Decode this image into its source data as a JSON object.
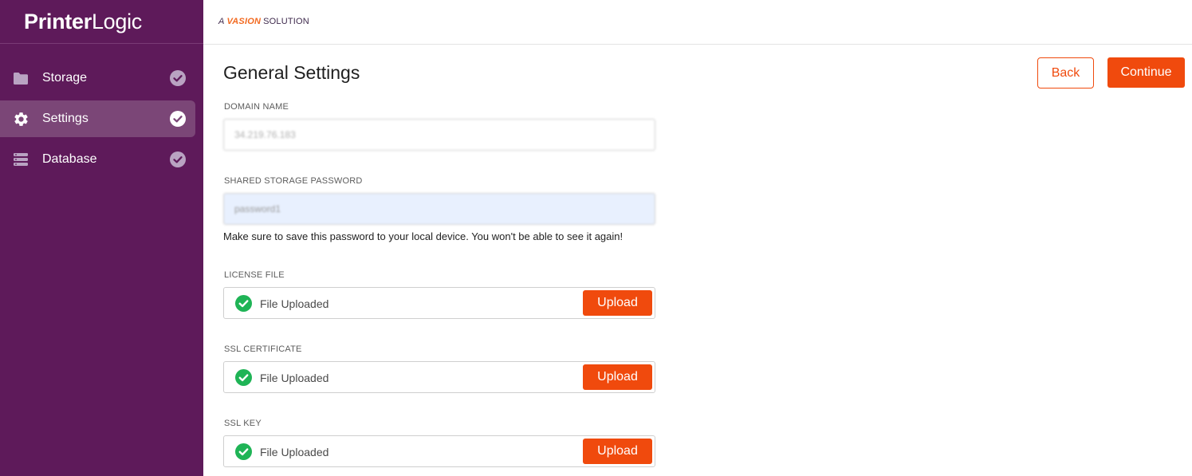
{
  "brand": {
    "logo_bold": "Printer",
    "logo_light": "Logic",
    "tagline_prefix": "A",
    "tagline_brand": "VASION",
    "tagline_suffix": "SOLUTION",
    "accent": "#f04a0d",
    "sidebar_bg": "#5e1a5a"
  },
  "sidebar": {
    "items": [
      {
        "label": "Storage",
        "icon": "folder-icon",
        "active": false,
        "status": "complete"
      },
      {
        "label": "Settings",
        "icon": "gear-icon",
        "active": true,
        "status": "complete"
      },
      {
        "label": "Database",
        "icon": "database-icon",
        "active": false,
        "status": "complete"
      }
    ]
  },
  "header": {
    "title": "General Settings",
    "back_label": "Back",
    "continue_label": "Continue"
  },
  "form": {
    "domain": {
      "label": "DOMAIN NAME",
      "value": "34.219.76.183"
    },
    "password": {
      "label": "SHARED STORAGE PASSWORD",
      "value": "password1",
      "helper": "Make sure to save this password to your local device. You won't be able to see it again!"
    },
    "license": {
      "label": "LICENSE FILE",
      "status": "File Uploaded",
      "upload_label": "Upload"
    },
    "ssl_cert": {
      "label": "SSL CERTIFICATE",
      "status": "File Uploaded",
      "upload_label": "Upload"
    },
    "ssl_key": {
      "label": "SSL KEY",
      "status": "File Uploaded",
      "upload_label": "Upload"
    }
  }
}
